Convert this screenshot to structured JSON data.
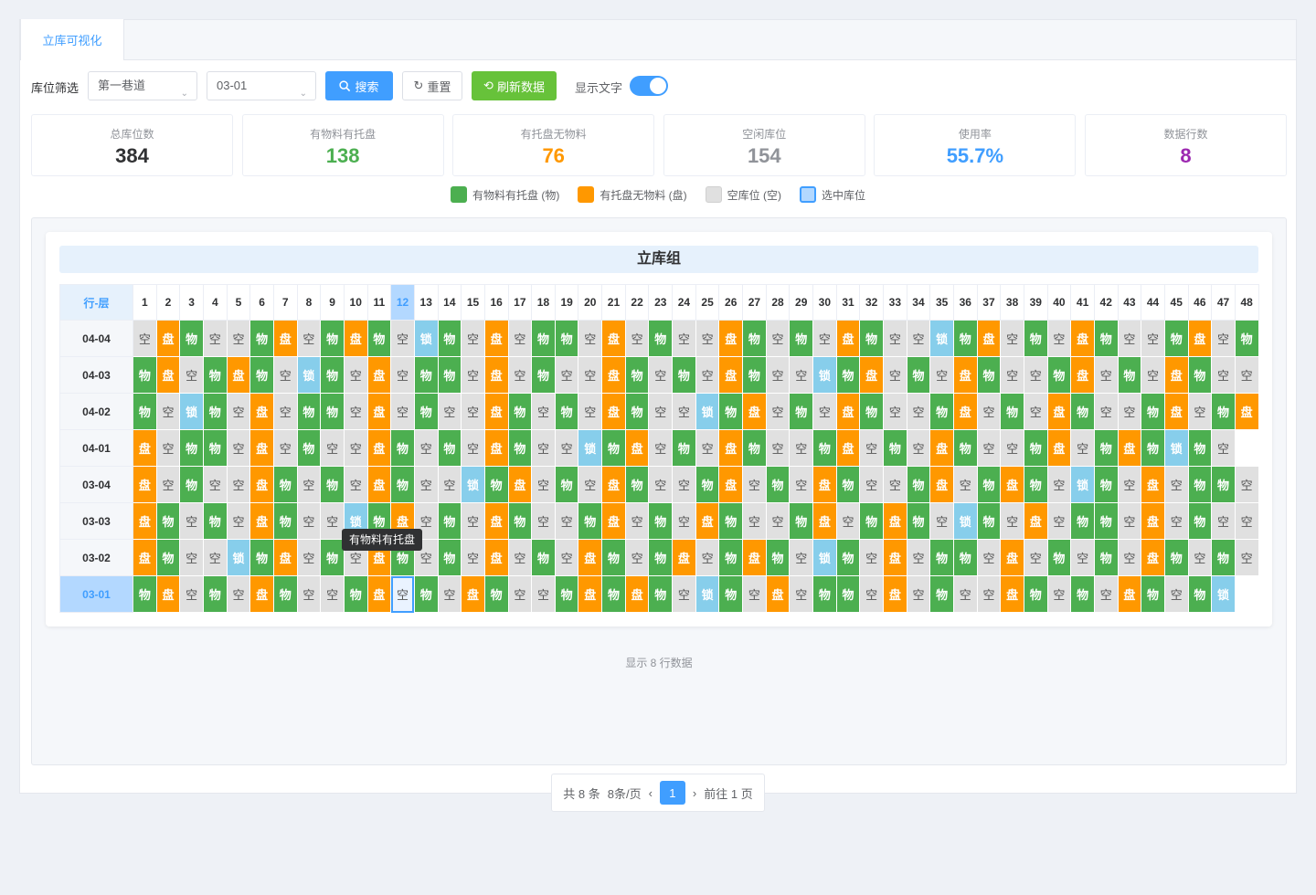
{
  "tabs": {
    "active": "立库可视化"
  },
  "filter": {
    "label": "库位筛选",
    "aisle": "第一巷道",
    "layer": "03-01",
    "search": "搜索",
    "reset": "重置",
    "refresh": "刷新数据",
    "show_text": "显示文字",
    "show_text_on": true
  },
  "stats": [
    {
      "title": "总库位数",
      "value": "384",
      "color": "#303133"
    },
    {
      "title": "有物料有托盘",
      "value": "138",
      "color": "#4caf50"
    },
    {
      "title": "有托盘无物料",
      "value": "76",
      "color": "#ff9800"
    },
    {
      "title": "空闲库位",
      "value": "154",
      "color": "#909399"
    },
    {
      "title": "使用率",
      "value": "55.7%",
      "color": "#409eff"
    },
    {
      "title": "数据行数",
      "value": "8",
      "color": "#9c27b0"
    }
  ],
  "legend": [
    {
      "label": "有物料有托盘 (物)",
      "color": "#4caf50"
    },
    {
      "label": "有托盘无物料 (盘)",
      "color": "#ff9800"
    },
    {
      "label": "空库位 (空)",
      "color": "#e0e0e0"
    },
    {
      "label": "选中库位",
      "color": "#b3d8ff"
    }
  ],
  "grid": {
    "title": "立库组",
    "corner": "行-层",
    "selected_row": "03-01",
    "selected_col": 12,
    "rows": [
      {
        "label": "04-04",
        "cells": "空盘物空空物盘空物盘物空锁物空盘空物物空盘空物空空盘物空物空盘物空空锁物盘空物空盘物空空物盘空物"
      },
      {
        "label": "04-03",
        "cells": "物盘空物盘物空锁物空盘空物物空盘空物空空盘物空物空盘物空空锁物盘空物空盘物空空物盘空物空盘物空空"
      },
      {
        "label": "04-02",
        "cells": "物空锁物空盘空物物空盘空物空空盘物空物空盘物空空锁物盘空物空盘物空空物盘空物空盘物空空物盘空物盘"
      },
      {
        "label": "04-01",
        "cells": "盘空物物空盘空物空空盘物空物空盘物空空锁物盘空物空盘物空空物盘空物空盘物空空物盘空物盘物锁物空"
      },
      {
        "label": "03-04",
        "cells": "盘空物空空盘物空物空盘物空空锁物盘空物空盘物空空物盘空物空盘物空空物盘空物盘物空锁物空盘空物物空"
      },
      {
        "label": "03-03",
        "cells": "盘物空物空盘物空空锁物盘空物空盘物空空物盘空物空盘物空空物盘空物盘物空锁物空盘空物物空盘空物空空"
      },
      {
        "label": "03-02",
        "cells": "盘物空空锁物盘空物空盘物空物空盘空物空盘物空物盘空物盘物空锁物空盘空物物空盘空物空物空盘物空物空"
      },
      {
        "label": "03-01",
        "cells": "物盘空物空盘物空空物盘空物空盘物空空物盘物盘物空锁物空盘空物物空盘空物空空盘物空物空盘物空物锁"
      }
    ]
  },
  "tooltip": "有物料有托盘",
  "footer_note": "显示 8 行数据",
  "pager": {
    "total": "共 8 条",
    "page_size": "8条/页",
    "prev": "‹",
    "current": "1",
    "next": "›",
    "goto": "前往 1 页"
  }
}
